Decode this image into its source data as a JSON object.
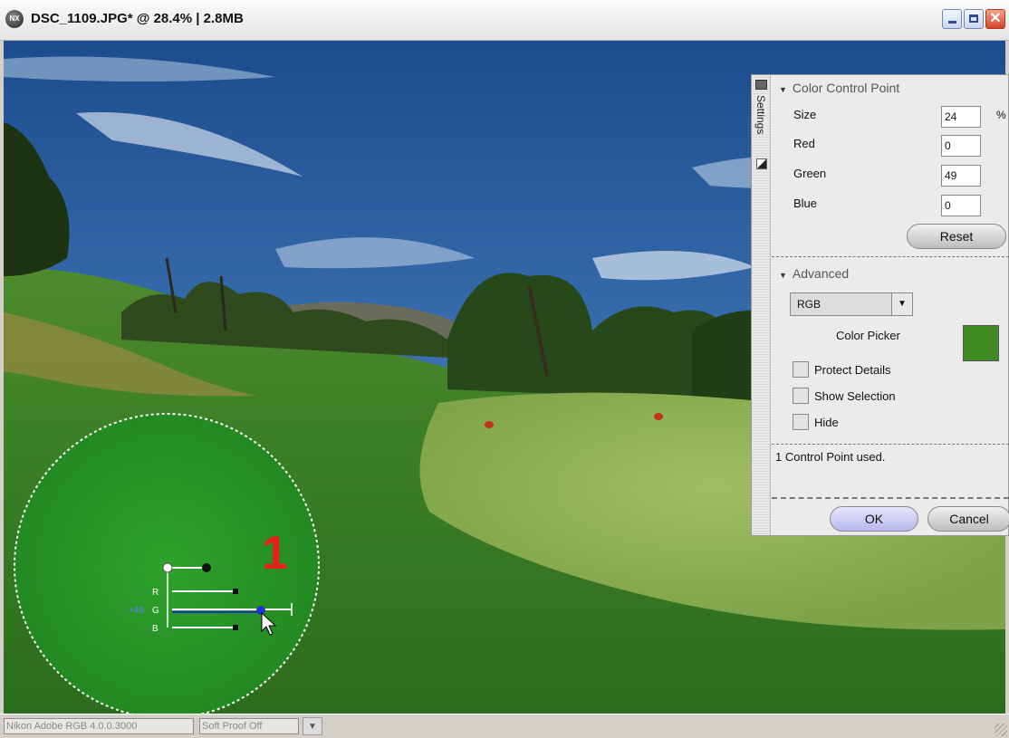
{
  "window": {
    "title": "DSC_1109.JPG* @ 28.4% | 2.8MB",
    "app_icon": "NX",
    "icons": [
      "nikon-nx-icon",
      "minimize-icon",
      "maximize-icon",
      "close-icon"
    ]
  },
  "image": {
    "control_point_number": "1",
    "control_point_slider_labels": [
      "R",
      "G",
      "B"
    ],
    "control_point_value_label": "+49"
  },
  "panel": {
    "side_tab_label": "Settings",
    "color_control_point": {
      "title": "Color Control Point",
      "size_label": "Size",
      "size_value": "24",
      "size_unit": "%",
      "red_label": "Red",
      "red_value": "0",
      "green_label": "Green",
      "green_value": "49",
      "blue_label": "Blue",
      "blue_value": "0",
      "reset_label": "Reset"
    },
    "advanced": {
      "title": "Advanced",
      "mode_selected": "RGB",
      "color_picker_label": "Color Picker",
      "picker_color": "#3f8a22",
      "checkboxes": [
        {
          "label": "Protect Details",
          "checked": false
        },
        {
          "label": "Show Selection",
          "checked": false
        },
        {
          "label": "Hide",
          "checked": false
        }
      ]
    },
    "status_text": "1 Control Point used.",
    "ok_label": "OK",
    "cancel_label": "Cancel"
  },
  "statusbar": {
    "color_profile": "Nikon Adobe RGB 4.0.0.3000",
    "soft_proof": "Soft Proof Off"
  }
}
